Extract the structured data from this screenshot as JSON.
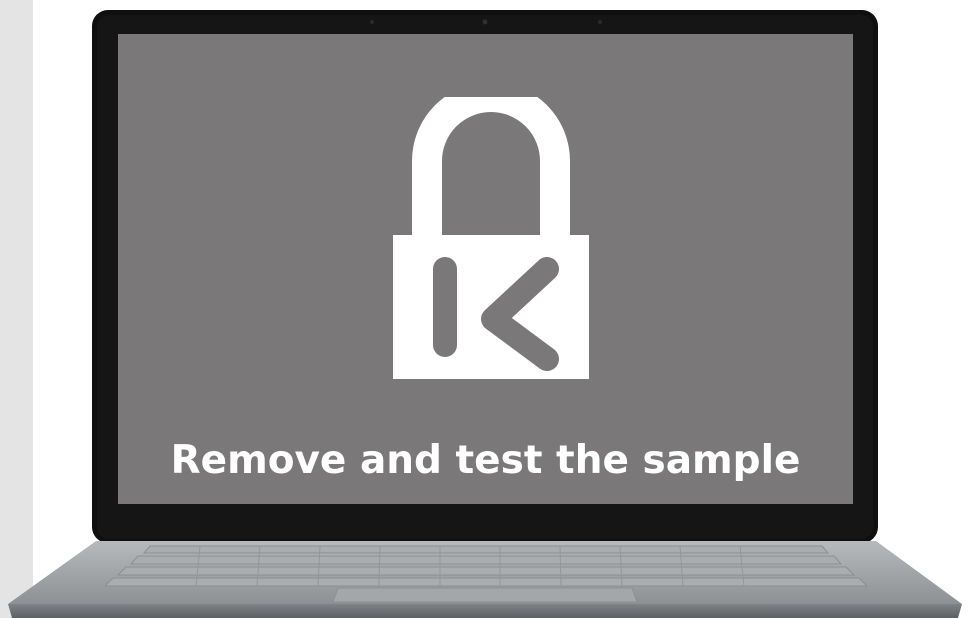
{
  "screen": {
    "caption": "Remove and test the sample",
    "background_color": "#7a7878",
    "icon": "kensington-lock-icon",
    "icon_color": "#ffffff"
  },
  "device": {
    "type": "laptop",
    "bezel_color": "#111111",
    "body_color": "#9ea2a5"
  }
}
